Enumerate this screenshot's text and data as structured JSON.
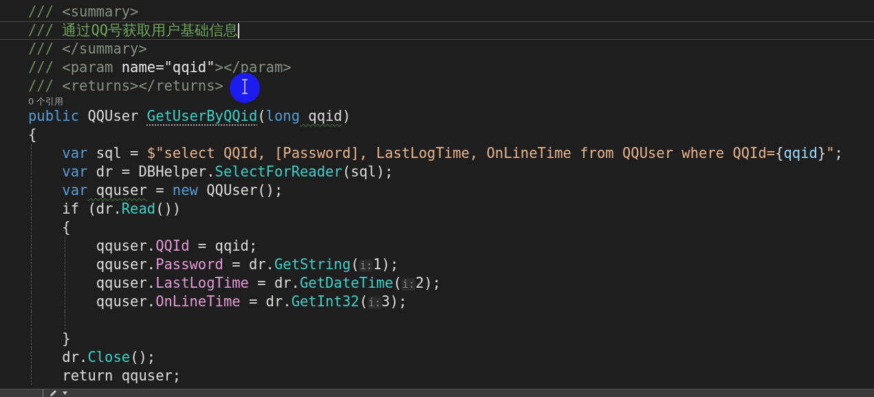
{
  "editor": {
    "lines": [
      {
        "kind": "code",
        "tokens": [
          {
            "text": "///",
            "kind": "doc"
          },
          {
            "text": " <summary>",
            "kind": "doctag"
          }
        ]
      },
      {
        "kind": "code",
        "current": true,
        "tokens": [
          {
            "text": "/// ",
            "kind": "doc"
          },
          {
            "text": "通过QQ号获取用户基础信息",
            "kind": "comment"
          }
        ]
      },
      {
        "kind": "code",
        "tokens": [
          {
            "text": "///",
            "kind": "doc"
          },
          {
            "text": " </summary>",
            "kind": "doctag"
          }
        ]
      },
      {
        "kind": "code",
        "tokens": [
          {
            "text": "///",
            "kind": "doc"
          },
          {
            "text": " <param ",
            "kind": "doctag"
          },
          {
            "text": "name=\"qqid\"",
            "kind": "docattr"
          },
          {
            "text": "></param>",
            "kind": "doctag"
          }
        ]
      },
      {
        "kind": "code",
        "tokens": [
          {
            "text": "///",
            "kind": "doc"
          },
          {
            "text": " <returns></returns>",
            "kind": "doctag"
          }
        ]
      },
      {
        "kind": "codelens",
        "text": "0 个引用"
      },
      {
        "kind": "code",
        "tokens": [
          {
            "text": "public",
            "kind": "keyword"
          },
          {
            "text": " QQUser ",
            "kind": "plain"
          },
          {
            "text": "GetUserByQQid",
            "kind": "method",
            "suggestion": true
          },
          {
            "text": "(",
            "kind": "plain"
          },
          {
            "text": "long",
            "kind": "keyword"
          },
          {
            "text": " qqid",
            "kind": "plain",
            "warning": true
          },
          {
            "text": ")",
            "kind": "plain"
          }
        ]
      },
      {
        "kind": "code",
        "tokens": [
          {
            "text": "{",
            "kind": "plain"
          }
        ]
      },
      {
        "kind": "code",
        "tokens": [
          {
            "text": "    var",
            "kind": "keyword"
          },
          {
            "text": " sql = ",
            "kind": "plain"
          },
          {
            "text": "$\"select QQId, [Password], LastLogTime, OnLineTime from QQUser where QQId=",
            "kind": "string"
          },
          {
            "text": "{",
            "kind": "plain"
          },
          {
            "text": "qqid",
            "kind": "param"
          },
          {
            "text": "}",
            "kind": "plain"
          },
          {
            "text": "\"",
            "kind": "string"
          },
          {
            "text": ";",
            "kind": "plain"
          }
        ]
      },
      {
        "kind": "code",
        "tokens": [
          {
            "text": "    var",
            "kind": "keyword"
          },
          {
            "text": " dr = DBHelper.",
            "kind": "plain"
          },
          {
            "text": "SelectForReader",
            "kind": "method"
          },
          {
            "text": "(sql);",
            "kind": "plain"
          }
        ]
      },
      {
        "kind": "code",
        "tokens": [
          {
            "text": "    var",
            "kind": "keyword"
          },
          {
            "text": " qquser",
            "kind": "plain",
            "warning": true
          },
          {
            "text": " = ",
            "kind": "plain"
          },
          {
            "text": "new",
            "kind": "keyword"
          },
          {
            "text": " QQUser();",
            "kind": "plain"
          }
        ]
      },
      {
        "kind": "code",
        "tokens": [
          {
            "text": "    if (dr.",
            "kind": "plain"
          },
          {
            "text": "Read",
            "kind": "method"
          },
          {
            "text": "())",
            "kind": "plain"
          }
        ]
      },
      {
        "kind": "code",
        "tokens": [
          {
            "text": "    {",
            "kind": "plain"
          }
        ]
      },
      {
        "kind": "code",
        "tokens": [
          {
            "text": "        qquser.",
            "kind": "plain"
          },
          {
            "text": "QQId",
            "kind": "property"
          },
          {
            "text": " = qqid;",
            "kind": "plain"
          }
        ]
      },
      {
        "kind": "code",
        "tokens": [
          {
            "text": "        qquser.",
            "kind": "plain"
          },
          {
            "text": "Password",
            "kind": "property"
          },
          {
            "text": " = dr.",
            "kind": "plain"
          },
          {
            "text": "GetString",
            "kind": "method"
          },
          {
            "text": "(",
            "kind": "plain"
          },
          {
            "text": "i:",
            "kind": "hint"
          },
          {
            "text": "1);",
            "kind": "plain"
          }
        ]
      },
      {
        "kind": "code",
        "tokens": [
          {
            "text": "        qquser.",
            "kind": "plain"
          },
          {
            "text": "LastLogTime",
            "kind": "property"
          },
          {
            "text": " = dr.",
            "kind": "plain"
          },
          {
            "text": "GetDateTime",
            "kind": "method"
          },
          {
            "text": "(",
            "kind": "plain"
          },
          {
            "text": "i:",
            "kind": "hint"
          },
          {
            "text": "2);",
            "kind": "plain"
          }
        ]
      },
      {
        "kind": "code",
        "tokens": [
          {
            "text": "        qquser.",
            "kind": "plain"
          },
          {
            "text": "OnLineTime",
            "kind": "property"
          },
          {
            "text": " = dr.",
            "kind": "plain"
          },
          {
            "text": "GetInt32",
            "kind": "method"
          },
          {
            "text": "(",
            "kind": "plain"
          },
          {
            "text": "i:",
            "kind": "hint"
          },
          {
            "text": "3);",
            "kind": "plain"
          }
        ]
      },
      {
        "kind": "blank"
      },
      {
        "kind": "code",
        "tokens": [
          {
            "text": "    }",
            "kind": "plain"
          }
        ]
      },
      {
        "kind": "code",
        "tokens": [
          {
            "text": "    dr.",
            "kind": "plain"
          },
          {
            "text": "Close",
            "kind": "method"
          },
          {
            "text": "();",
            "kind": "plain"
          }
        ]
      },
      {
        "kind": "code",
        "tokens": [
          {
            "text": "    return qquser;",
            "kind": "plain"
          }
        ]
      }
    ]
  }
}
